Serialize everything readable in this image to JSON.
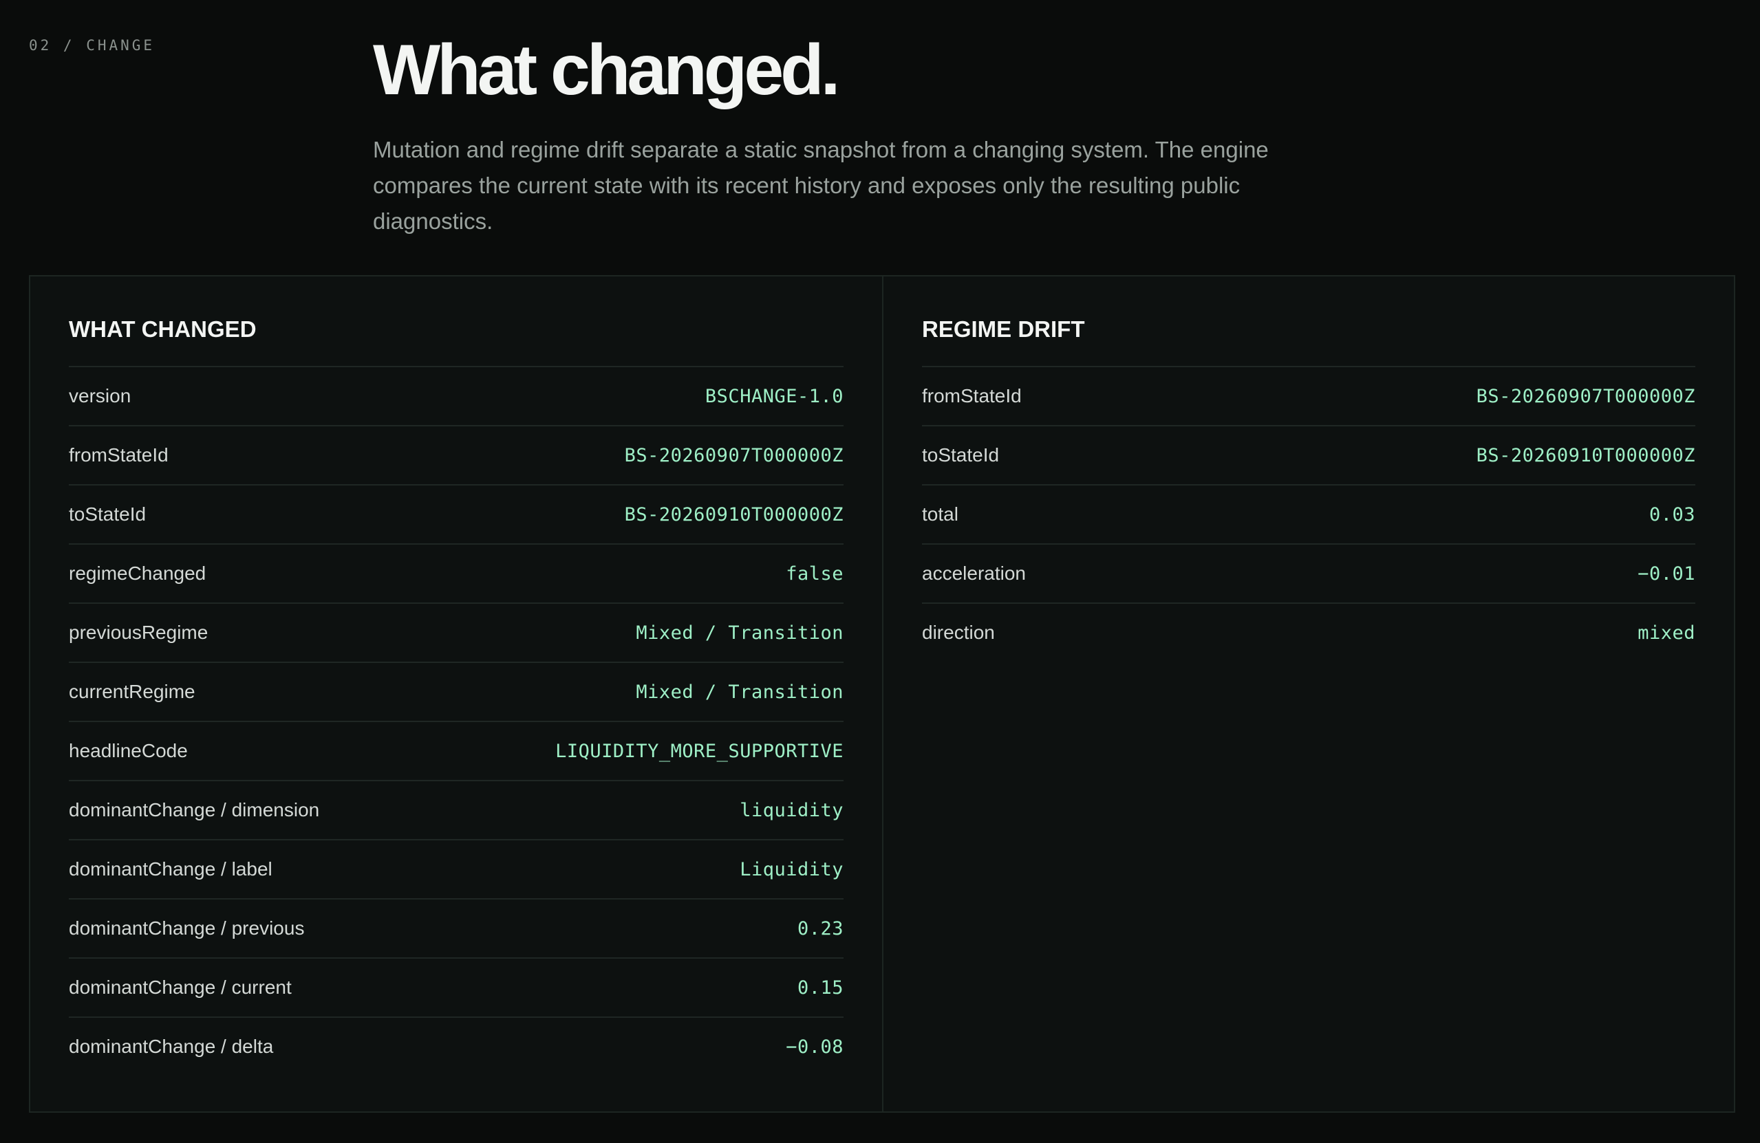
{
  "section": {
    "label": "02 / CHANGE"
  },
  "hero": {
    "title": "What changed.",
    "lede": "Mutation and regime drift separate a static snapshot from a changing system. The engine compares the current state with its recent history and exposes only the resulting public diagnostics."
  },
  "what_changed": {
    "title": "WHAT CHANGED",
    "rows": [
      {
        "key": "version",
        "value": "BSCHANGE-1.0"
      },
      {
        "key": "fromStateId",
        "value": "BS-20260907T000000Z"
      },
      {
        "key": "toStateId",
        "value": "BS-20260910T000000Z"
      },
      {
        "key": "regimeChanged",
        "value": "false"
      },
      {
        "key": "previousRegime",
        "value": "Mixed / Transition"
      },
      {
        "key": "currentRegime",
        "value": "Mixed / Transition"
      },
      {
        "key": "headlineCode",
        "value": "LIQUIDITY_MORE_SUPPORTIVE"
      },
      {
        "key": "dominantChange / dimension",
        "value": "liquidity"
      },
      {
        "key": "dominantChange / label",
        "value": "Liquidity"
      },
      {
        "key": "dominantChange / previous",
        "value": "0.23"
      },
      {
        "key": "dominantChange / current",
        "value": "0.15"
      },
      {
        "key": "dominantChange / delta",
        "value": "−0.08"
      }
    ]
  },
  "regime_drift": {
    "title": "REGIME DRIFT",
    "rows": [
      {
        "key": "fromStateId",
        "value": "BS-20260907T000000Z"
      },
      {
        "key": "toStateId",
        "value": "BS-20260910T000000Z"
      },
      {
        "key": "total",
        "value": "0.03"
      },
      {
        "key": "acceleration",
        "value": "−0.01"
      },
      {
        "key": "direction",
        "value": "mixed"
      }
    ]
  },
  "colors": {
    "background": "#0a0c0b",
    "panel": "#0d1110",
    "accent_value": "#9eefc6",
    "divider": "#1f2724"
  }
}
